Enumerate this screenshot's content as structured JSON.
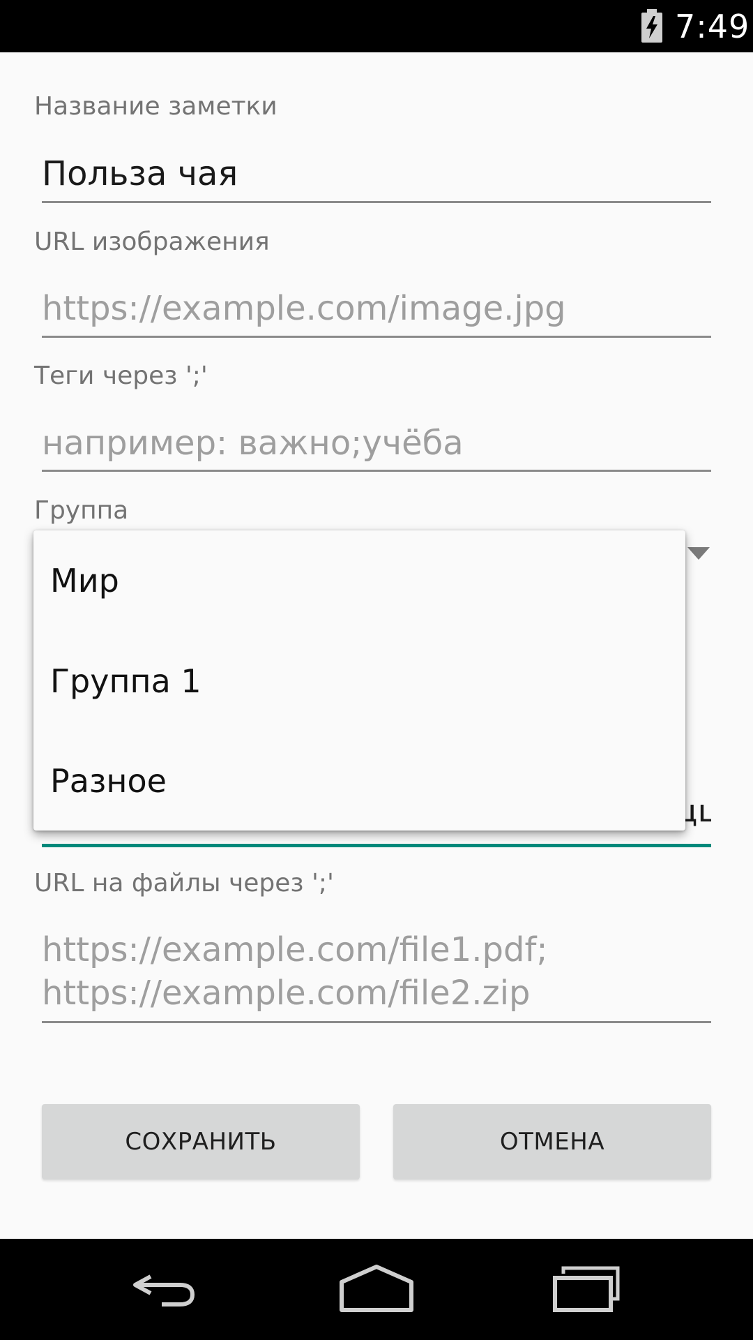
{
  "status_bar": {
    "time": "7:49",
    "battery_icon": "battery-charging-icon"
  },
  "form": {
    "title_label": "Название заметки",
    "title_value": "Польза чая",
    "image_url_label": "URL изображения",
    "image_url_placeholder": "https://example.com/image.jpg",
    "tags_label": "Теги через ';'",
    "tags_placeholder": "например: важно;учёба",
    "group_label": "Группа",
    "files_label": "URL на файлы через ';'",
    "files_placeholder": "https://example.com/file1.pdf; https://example.com/file2.zip"
  },
  "dropdown": {
    "options": [
      "Мир",
      "Группа 1",
      "Разное"
    ]
  },
  "buttons": {
    "save_label": "СОХРАНИТЬ",
    "cancel_label": "ОТМЕНА"
  },
  "nav_bar": {
    "back_icon": "back-icon",
    "home_icon": "home-icon",
    "recents_icon": "recents-icon"
  }
}
